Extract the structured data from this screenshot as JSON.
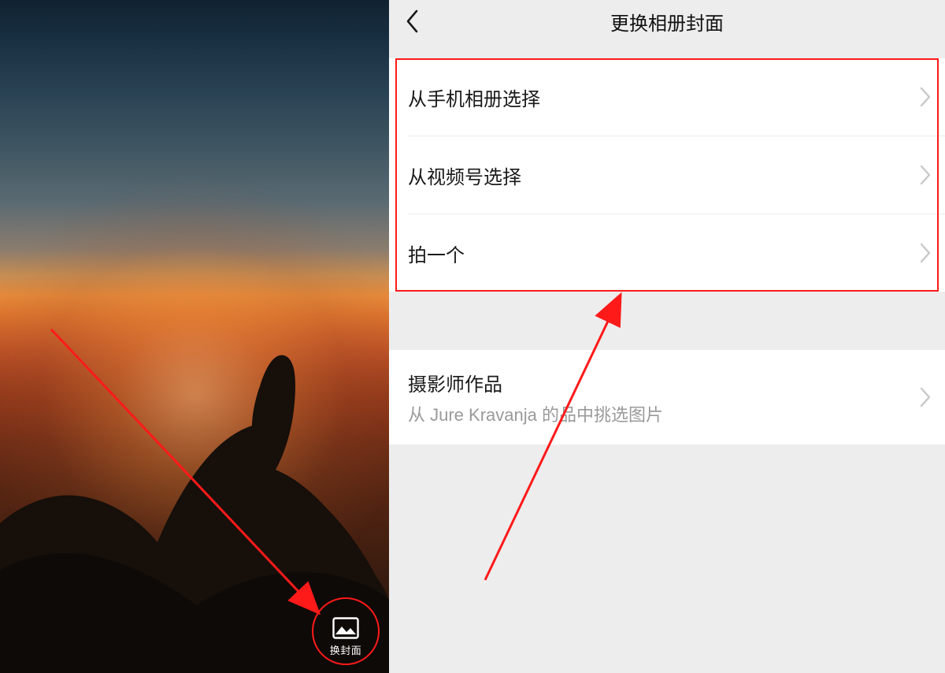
{
  "left": {
    "change_cover_label": "换封面"
  },
  "right": {
    "nav_title": "更换相册封面",
    "options": [
      {
        "label": "从手机相册选择"
      },
      {
        "label": "从视频号选择"
      },
      {
        "label": "拍一个"
      }
    ],
    "photographer": {
      "label": "摄影师作品",
      "subtitle": "从 Jure Kravanja 的品中挑选图片"
    }
  },
  "annotation": {
    "color": "#ff1a1a"
  }
}
